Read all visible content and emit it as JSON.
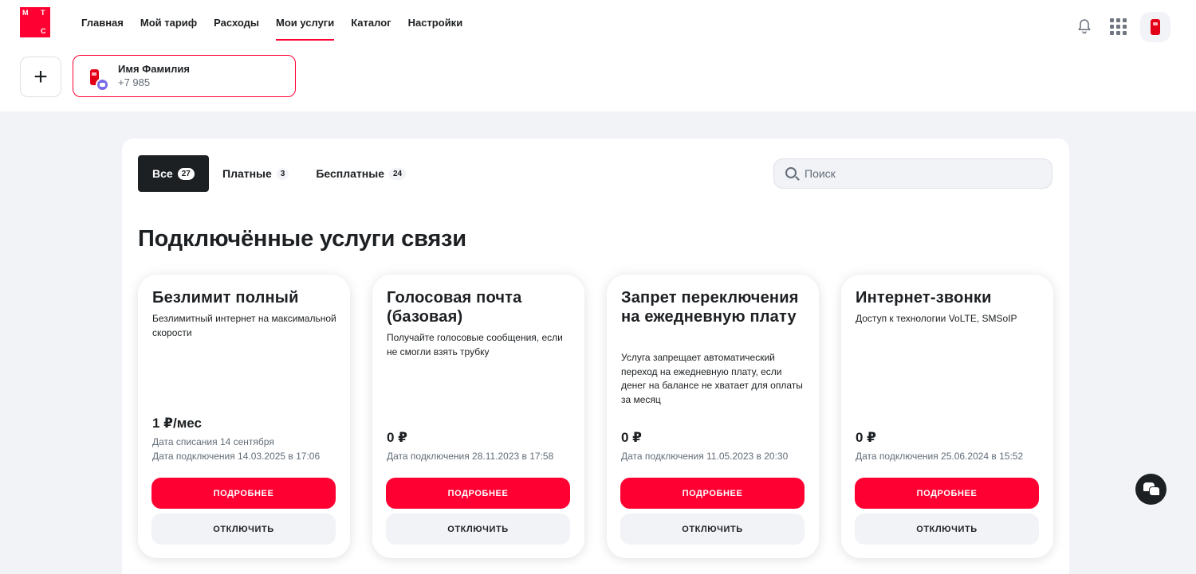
{
  "logo": {
    "letters": [
      "М",
      "Т",
      "С"
    ]
  },
  "nav": [
    {
      "label": "Главная",
      "active": false
    },
    {
      "label": "Мой тариф",
      "active": false
    },
    {
      "label": "Расходы",
      "active": false
    },
    {
      "label": "Мои услуги",
      "active": true
    },
    {
      "label": "Каталог",
      "active": false
    },
    {
      "label": "Настройки",
      "active": false
    }
  ],
  "header_icons": [
    "bell-icon",
    "apps-grid-icon",
    "phone-avatar-icon"
  ],
  "account": {
    "add_label": "+",
    "name": "Имя Фамилия",
    "number": "+7 985"
  },
  "tabs": [
    {
      "label": "Все",
      "count": "27",
      "active": true
    },
    {
      "label": "Платные",
      "count": "3",
      "active": false
    },
    {
      "label": "Бесплатные",
      "count": "24",
      "active": false
    }
  ],
  "search": {
    "placeholder": "Поиск",
    "value": ""
  },
  "section_title": "Подключённые услуги связи",
  "cards": [
    {
      "title": "Безлимит полный",
      "description": "Безлимитный интернет на максимальной скорости",
      "price": "1 ₽/мес",
      "charge_date": "Дата списания 14 сентября",
      "connect_date": "Дата подключения 14.03.2025 в 17:06",
      "details_label": "ПОДРОБНЕЕ",
      "disable_label": "ОТКЛЮЧИТЬ"
    },
    {
      "title": "Голосовая почта (базовая)",
      "description": "Получайте голосовые сообщения, если не смогли взять трубку",
      "price": "0 ₽",
      "connect_date": "Дата подключения 28.11.2023 в 17:58",
      "details_label": "ПОДРОБНЕЕ",
      "disable_label": "ОТКЛЮЧИТЬ"
    },
    {
      "title": "Запрет переключения на ежедневную плату",
      "description": "Услуга запрещает автоматический переход на ежедневную плату, если денег на балансе не хватает для оплаты за месяц",
      "price": "0 ₽",
      "connect_date": "Дата подключения 11.05.2023 в 20:30",
      "details_label": "ПОДРОБНЕЕ",
      "disable_label": "ОТКЛЮЧИТЬ"
    },
    {
      "title": "Интернет-звонки",
      "description": "Доступ к технологии VoLTE, SMSoIP",
      "price": "0 ₽",
      "connect_date": "Дата подключения 25.06.2024 в 15:52",
      "details_label": "ПОДРОБНЕЕ",
      "disable_label": "ОТКЛЮЧИТЬ"
    }
  ],
  "colors": {
    "brand": "#ff0032",
    "dark": "#1d2023",
    "muted": "#626c77",
    "background": "#f2f3f7"
  }
}
